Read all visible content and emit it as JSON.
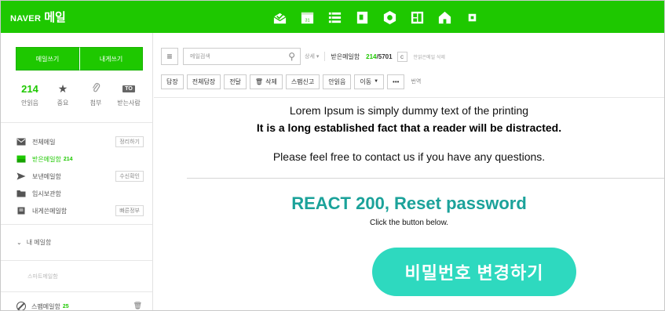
{
  "header": {
    "brand_naver": "NAVER",
    "brand_mail": "메일",
    "apps": [
      "mail-icon",
      "calendar-icon",
      "contacts-icon",
      "memo-icon",
      "drive-icon",
      "office-icon",
      "home-icon",
      "more-icon"
    ]
  },
  "sidebar": {
    "compose_label": "메일쓰기",
    "self_compose_label": "내게쓰기",
    "quick": [
      {
        "value": "214",
        "label": "안읽음"
      },
      {
        "label": "중요"
      },
      {
        "label": "첨부"
      },
      {
        "badge": "TO",
        "label": "받는사람"
      }
    ],
    "folders": [
      {
        "name": "전체메일",
        "action": "정리하기"
      },
      {
        "name": "받은메일함",
        "count": "214"
      },
      {
        "name": "보낸메일함",
        "action": "수신확인"
      },
      {
        "name": "임시보관함"
      },
      {
        "name": "내게쓴메일함",
        "action": "빠른정부"
      }
    ],
    "my_mail_label": "내 메일함",
    "smart_label": "스마트메일함",
    "spam_label": "스팸메일함",
    "spam_count": "25"
  },
  "toolbar": {
    "search_placeholder": "메일검색",
    "detail_label": "상세 ▾",
    "folder_title": "받은메일함",
    "unread_count": "214",
    "total_count": "/5701",
    "refresh_label": "c",
    "markall_label": "안읽은메일 삭제",
    "buttons": [
      "답장",
      "전체답장",
      "전달",
      "삭제",
      "스팸신고",
      "안읽음",
      "이동",
      "•••"
    ],
    "translate_label": "번역"
  },
  "mail": {
    "line1": "Lorem Ipsum is simply dummy text of the printing",
    "line2": "It is a long established fact that a reader will be distracted.",
    "line3": "Please feel free to contact us if you have any questions.",
    "title": "REACT 200, Reset password",
    "note": "Click the button below.",
    "cta": "비밀번호 변경하기"
  },
  "colors": {
    "naver_green": "#1ec800",
    "title_teal": "#1ba29a",
    "cta_teal": "#2ed9bf"
  }
}
